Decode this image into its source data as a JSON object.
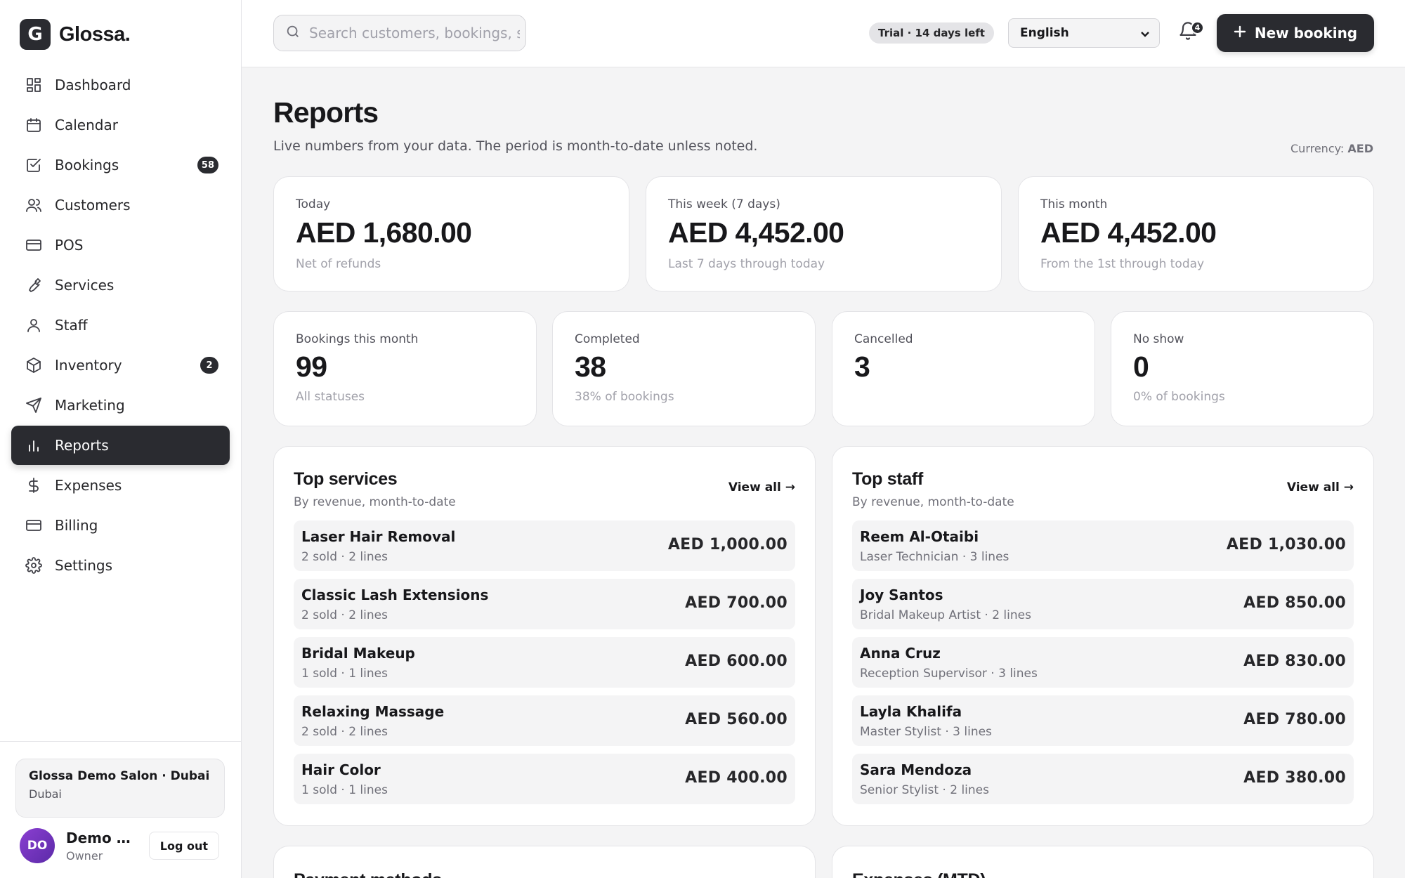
{
  "brand": {
    "logo_letter": "G",
    "name": "Glossa."
  },
  "nav": {
    "items": [
      {
        "label": "Dashboard",
        "icon": "dashboard-icon"
      },
      {
        "label": "Calendar",
        "icon": "calendar-icon"
      },
      {
        "label": "Bookings",
        "icon": "bookings-icon",
        "badge": "58"
      },
      {
        "label": "Customers",
        "icon": "customers-icon"
      },
      {
        "label": "POS",
        "icon": "pos-icon"
      },
      {
        "label": "Services",
        "icon": "services-icon"
      },
      {
        "label": "Staff",
        "icon": "staff-icon"
      },
      {
        "label": "Inventory",
        "icon": "inventory-icon",
        "badge": "2"
      },
      {
        "label": "Marketing",
        "icon": "marketing-icon"
      },
      {
        "label": "Reports",
        "icon": "reports-icon",
        "active": true
      },
      {
        "label": "Expenses",
        "icon": "expenses-icon"
      },
      {
        "label": "Billing",
        "icon": "billing-icon"
      },
      {
        "label": "Settings",
        "icon": "settings-icon"
      }
    ]
  },
  "sidebar_footer": {
    "salon_name": "Glossa Demo Salon · Dubai",
    "salon_city": "Dubai",
    "avatar_initials": "DO",
    "user_name": "Demo Owner",
    "user_role": "Owner",
    "logout_label": "Log out"
  },
  "topbar": {
    "search_placeholder": "Search customers, bookings, services",
    "trial_badge": "Trial · 14 days left",
    "language": "English",
    "notification_count": "4",
    "new_booking_label": "New booking"
  },
  "page": {
    "title": "Reports",
    "subtitle": "Live numbers from your data. The period is month-to-date unless noted.",
    "currency_label": "Currency:",
    "currency_value": "AED"
  },
  "revenue_cards": [
    {
      "label": "Today",
      "value": "AED 1,680.00",
      "note": "Net of refunds"
    },
    {
      "label": "This week (7 days)",
      "value": "AED 4,452.00",
      "note": "Last 7 days through today"
    },
    {
      "label": "This month",
      "value": "AED 4,452.00",
      "note": "From the 1st through today"
    }
  ],
  "booking_cards": [
    {
      "label": "Bookings this month",
      "value": "99",
      "note": "All statuses"
    },
    {
      "label": "Completed",
      "value": "38",
      "note": "38% of bookings"
    },
    {
      "label": "Cancelled",
      "value": "3",
      "note": ""
    },
    {
      "label": "No show",
      "value": "0",
      "note": "0% of bookings"
    }
  ],
  "top_services": {
    "title": "Top services",
    "subtitle": "By revenue, month-to-date",
    "view_all": "View all →",
    "rows": [
      {
        "name": "Laser Hair Removal",
        "meta": "2 sold · 2 lines",
        "amount": "AED 1,000.00"
      },
      {
        "name": "Classic Lash Extensions",
        "meta": "2 sold · 2 lines",
        "amount": "AED 700.00"
      },
      {
        "name": "Bridal Makeup",
        "meta": "1 sold · 1 lines",
        "amount": "AED 600.00"
      },
      {
        "name": "Relaxing Massage",
        "meta": "2 sold · 2 lines",
        "amount": "AED 560.00"
      },
      {
        "name": "Hair Color",
        "meta": "1 sold · 1 lines",
        "amount": "AED 400.00"
      }
    ]
  },
  "top_staff": {
    "title": "Top staff",
    "subtitle": "By revenue, month-to-date",
    "view_all": "View all →",
    "rows": [
      {
        "name": "Reem Al-Otaibi",
        "meta": "Laser Technician · 3 lines",
        "amount": "AED 1,030.00"
      },
      {
        "name": "Joy Santos",
        "meta": "Bridal Makeup Artist · 2 lines",
        "amount": "AED 850.00"
      },
      {
        "name": "Anna Cruz",
        "meta": "Reception Supervisor · 3 lines",
        "amount": "AED 830.00"
      },
      {
        "name": "Layla Khalifa",
        "meta": "Master Stylist · 3 lines",
        "amount": "AED 780.00"
      },
      {
        "name": "Sara Mendoza",
        "meta": "Senior Stylist · 2 lines",
        "amount": "AED 380.00"
      }
    ]
  },
  "lower_panels": [
    {
      "title": "Payment methods"
    },
    {
      "title": "Expenses (MTD)"
    }
  ],
  "colors": {
    "accent_dark": "#2a2b30",
    "page_bg": "#f4f4f5",
    "card_bg": "#ffffff",
    "avatar": "#7c3aed"
  }
}
